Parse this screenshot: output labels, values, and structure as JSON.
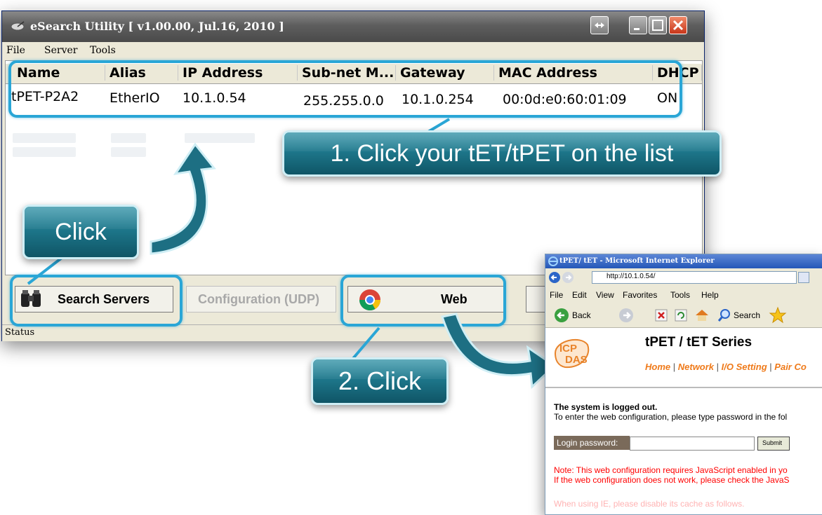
{
  "esearch": {
    "title": "eSearch Utility [ v1.00.00, Jul.16, 2010 ]",
    "menu": {
      "file": "File",
      "server": "Server",
      "tools": "Tools"
    },
    "columns": [
      "Name",
      "Alias",
      "IP Address",
      "Sub-net M...",
      "Gateway",
      "MAC Address",
      "DHCP"
    ],
    "row": {
      "name": "tPET-P2A2",
      "alias": "EtherIO",
      "ip": "10.1.0.54",
      "subnet": "255.255.0.0",
      "gateway": "10.1.0.254",
      "mac": "00:0d:e0:60:01:09",
      "dhcp": "ON"
    },
    "buttons": {
      "search": "Search Servers",
      "configuration": "Configuration (UDP)",
      "web": "Web"
    },
    "status": "Status"
  },
  "callouts": {
    "step1": "1. Click your tET/tPET on the list",
    "click": "Click",
    "step2": "2. Click"
  },
  "ie": {
    "title": "tPET/ tET - Microsoft Internet Explorer",
    "address": "http://10.1.0.54/",
    "menu": [
      "File",
      "Edit",
      "View",
      "Favorites",
      "Tools",
      "Help"
    ],
    "toolbar": {
      "back": "Back",
      "search": "Search"
    },
    "logo": "ICP DAS",
    "heading": "tPET / tET Series",
    "nav": {
      "home": "Home",
      "network": "Network",
      "io": "I/O Setting",
      "pair": "Pair Co"
    },
    "logged_out": "The system is logged out.",
    "instructions": "To enter the web configuration, please type password in the fol",
    "login_label": "Login password:",
    "submit": "Submit",
    "note1": "Note: This web configuration requires JavaScript enabled in yo",
    "note2": "If the web configuration does not work, please check the JavaS",
    "note3": "When using IE, please disable its cache as follows."
  },
  "colors": {
    "highlight": "#2aa6d6",
    "callout": "#1f7a8e",
    "ie_nav": "#ef7a1a",
    "ie_note": "#ff0000"
  }
}
